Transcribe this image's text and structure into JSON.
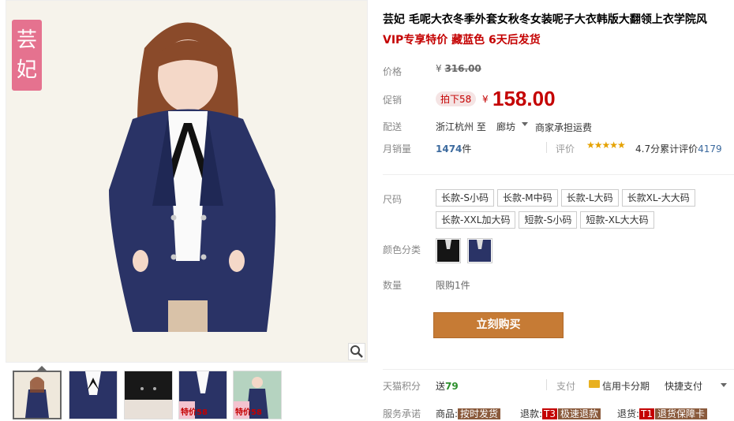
{
  "gallery": {
    "brand_badge": [
      "芸",
      "妃"
    ],
    "zoom_icon": "magnifier-icon",
    "thumbnails": [
      {
        "label": "",
        "active": true
      },
      {
        "label": "",
        "active": false
      },
      {
        "label": "",
        "active": false
      },
      {
        "label": "特价58",
        "active": false
      },
      {
        "label": "特价58",
        "active": false
      }
    ]
  },
  "product": {
    "title": "芸妃 毛呢大衣冬季外套女秋冬女装呢子大衣韩版大翻领上衣学院风",
    "subtitle": "VIP专享特价 藏蓝色 6天后发货"
  },
  "meta": {
    "price_label": "价格",
    "original_price_yen": "¥",
    "original_price": "316.00",
    "promo_label": "促销",
    "promo_tag": "拍下58",
    "promo_yen": "¥",
    "promo_price": "158.00",
    "ship_label": "配送",
    "ship_from": "浙江杭州 至",
    "ship_to": "廊坊",
    "ship_note": "商家承担运费",
    "sales_label": "月销量",
    "sales_count": "1474",
    "sales_unit": "件",
    "review_label": "评价",
    "stars": "★★★★★",
    "rating_text": "4.7分",
    "review_count_label": "累计评价",
    "review_count": "4179"
  },
  "options": {
    "size_label": "尺码",
    "sizes": [
      "长款-S小码",
      "长款-M中码",
      "长款-L大码",
      "长款XL-大大码",
      "长款-XXL加大码",
      "短款-S小码",
      "短款-XL大大码"
    ],
    "color_label": "颜色分类",
    "colors": [
      "black-swatch",
      "navy-swatch"
    ],
    "qty_label": "数量",
    "qty_limit": "限购1件",
    "buy_button": "立刻购买"
  },
  "footer": {
    "points_label": "天猫积分",
    "points_prefix": "送",
    "points_value": "79",
    "pay_label": "支付",
    "pay_card": "信用卡分期",
    "pay_quick": "快捷支付",
    "service_label": "服务承诺",
    "services": [
      {
        "prefix": "商品:",
        "code": "",
        "tag": "按时发货"
      },
      {
        "prefix": "退款:",
        "code": "T3",
        "tag": "极速退款"
      },
      {
        "prefix": "退货:",
        "code": "T1",
        "tag": "退货保障卡"
      }
    ]
  },
  "colors": {
    "accent_red": "#c40000",
    "buy_button": "#c67b35",
    "badge_pink": "#e5728f",
    "star_gold": "#e5a200"
  }
}
